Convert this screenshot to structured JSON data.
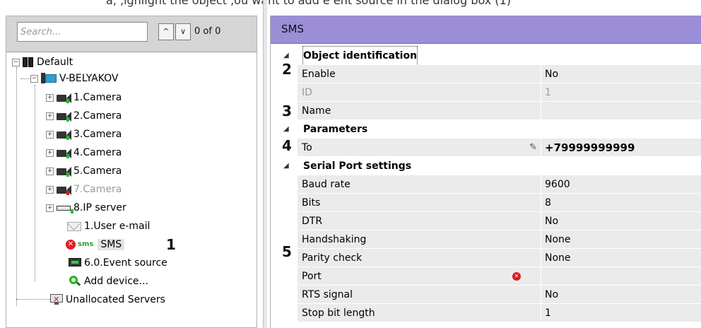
{
  "top_strip_text": "a, ,ighlight the object ,ou want to add e ent source in the dialog box (1)",
  "search": {
    "placeholder": "Search...",
    "up_glyph": "^",
    "down_glyph": "∨",
    "count": "0 of 0"
  },
  "tree": {
    "root": "Default",
    "server": "V-BELYAKOV",
    "cameras": [
      "1.Camera",
      "2.Camera",
      "3.Camera",
      "4.Camera",
      "5.Camera",
      "7.Camera"
    ],
    "ip_server": "8.IP server",
    "email": "1.User e-mail",
    "sms_tag": "sms",
    "sms": "SMS",
    "event_source": "6.0.Event source",
    "add_device": "Add device...",
    "unallocated": "Unallocated Servers",
    "callout_1": "1"
  },
  "panel": {
    "title": "SMS"
  },
  "properties": {
    "section_identification": "Object identification",
    "enable_label": "Enable",
    "enable_value": "No",
    "id_label": "ID",
    "id_value": "1",
    "name_label": "Name",
    "name_value": "",
    "section_parameters": "Parameters",
    "to_label": "To",
    "to_value": "+79999999999",
    "section_serial": "Serial Port settings",
    "baud_label": "Baud rate",
    "baud_value": "9600",
    "bits_label": "Bits",
    "bits_value": "8",
    "dtr_label": "DTR",
    "dtr_value": "No",
    "handshaking_label": "Handshaking",
    "handshaking_value": "None",
    "parity_label": "Parity check",
    "parity_value": "None",
    "port_label": "Port",
    "port_value": "",
    "rts_label": "RTS signal",
    "rts_value": "No",
    "stopbit_label": "Stop bit length",
    "stopbit_value": "1",
    "callout_2": "2",
    "callout_3": "3",
    "callout_4": "4",
    "callout_5": "5"
  },
  "icons": [
    "expand-icon",
    "collapse-icon",
    "default-group-icon",
    "server-icon",
    "camera-icon",
    "ip-server-icon",
    "email-icon",
    "error-icon",
    "event-source-icon",
    "add-device-icon",
    "unallocated-servers-icon",
    "pencil-icon",
    "collapse-triangle-icon"
  ],
  "colors": {
    "header_bg": "#9b8ed6",
    "row_bg": "#ebebeb",
    "error": "#d61f1f",
    "status_ok": "#1fbf2a"
  }
}
